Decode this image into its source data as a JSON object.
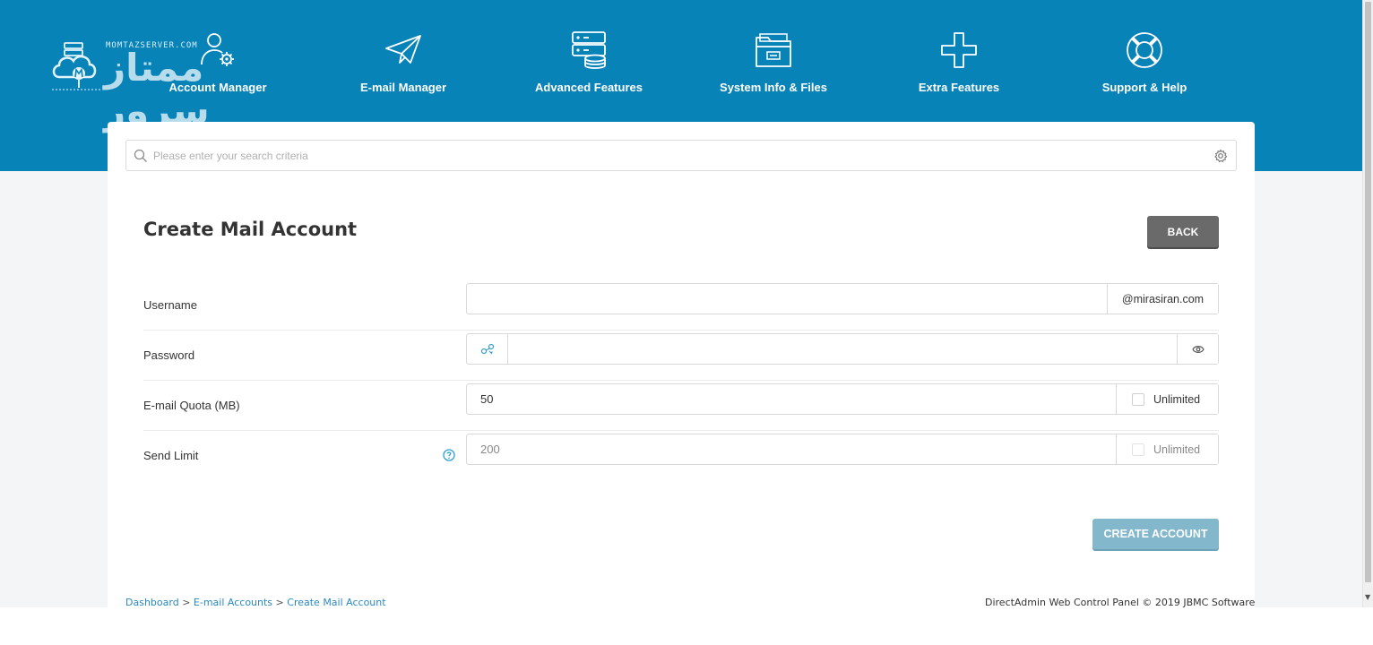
{
  "logo": {
    "small_text": "MOMTAZSERVER.COM",
    "big_text": "ممتاز سرور"
  },
  "nav": [
    {
      "label": "Account Manager",
      "icon": "user-gear-icon"
    },
    {
      "label": "E-mail Manager",
      "icon": "paper-plane-icon"
    },
    {
      "label": "Advanced Features",
      "icon": "server-database-icon"
    },
    {
      "label": "System Info & Files",
      "icon": "folder-icon"
    },
    {
      "label": "Extra Features",
      "icon": "plus-icon"
    },
    {
      "label": "Support & Help",
      "icon": "lifebuoy-icon"
    }
  ],
  "search": {
    "placeholder": "Please enter your search criteria",
    "value": ""
  },
  "page": {
    "title": "Create Mail Account",
    "back_label": "BACK"
  },
  "form": {
    "username": {
      "label": "Username",
      "value": "",
      "domain": "@mirasiran.com"
    },
    "password": {
      "label": "Password",
      "value": ""
    },
    "quota": {
      "label": "E-mail Quota (MB)",
      "value": "50",
      "unlimited_label": "Unlimited",
      "unlimited_checked": false
    },
    "send_limit": {
      "label": "Send Limit",
      "value": "200",
      "unlimited_label": "Unlimited",
      "unlimited_checked": false
    }
  },
  "create_label": "CREATE ACCOUNT",
  "breadcrumb": {
    "items": [
      "Dashboard",
      "E-mail Accounts",
      "Create Mail Account"
    ],
    "separator": ">"
  },
  "footer": {
    "text": "DirectAdmin Web Control Panel © 2019 JBMC Software"
  },
  "colors": {
    "header_bg": "#0883b8",
    "accent": "#2a88bf",
    "back_button": "#6a6a6a",
    "create_button": "#82b7cc"
  }
}
